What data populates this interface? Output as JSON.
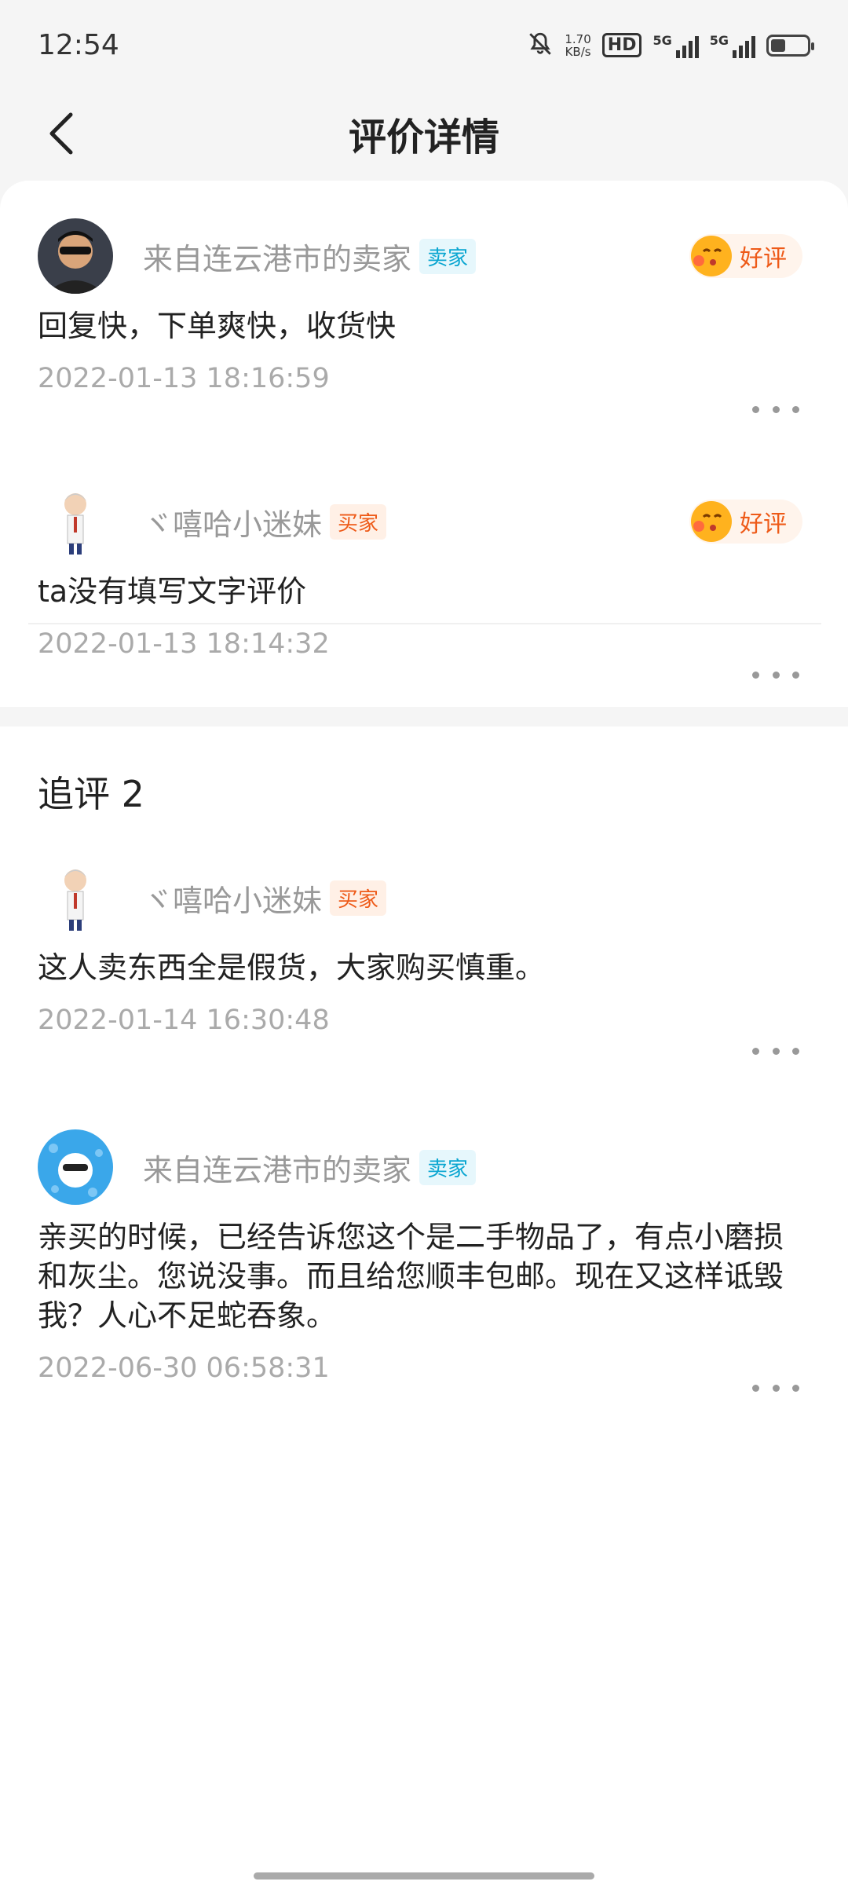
{
  "status_bar": {
    "time": "12:54",
    "net_speed_value": "1.70",
    "net_speed_unit": "KB/s",
    "hd_label": "HD",
    "signal_label": "5G",
    "signal2_label": "5G",
    "battery_level": 0.4,
    "icons": [
      "bell-muted-icon",
      "hd-icon",
      "signal-icon",
      "signal-icon",
      "battery-icon"
    ]
  },
  "nav": {
    "title": "评价详情"
  },
  "reviews": [
    {
      "user": "来自连云港市的卖家",
      "role": "卖家",
      "rating": "好评",
      "text": "回复快，下单爽快，收货快",
      "time": "2022-01-13 18:16:59"
    },
    {
      "user": "ヾ嘻哈小迷妹",
      "role": "买家",
      "rating": "好评",
      "text": "ta没有填写文字评价",
      "time": "2022-01-13 18:14:32"
    }
  ],
  "followups": {
    "title": "追评 2",
    "items": [
      {
        "user": "ヾ嘻哈小迷妹",
        "role": "买家",
        "text": "这人卖东西全是假货，大家购买慎重。",
        "time": "2022-01-14 16:30:48"
      },
      {
        "user": "来自连云港市的卖家",
        "role": "卖家",
        "text": "亲买的时候，已经告诉您这个是二手物品了，有点小磨损和灰尘。您说没事。而且给您顺丰包邮。现在又这样诋毁我？人心不足蛇吞象。",
        "time": "2022-06-30 06:58:31"
      }
    ]
  },
  "colors": {
    "seller_badge": "#0aa6d1",
    "buyer_badge": "#ee5a18",
    "good_rating": "#ee5a18"
  }
}
